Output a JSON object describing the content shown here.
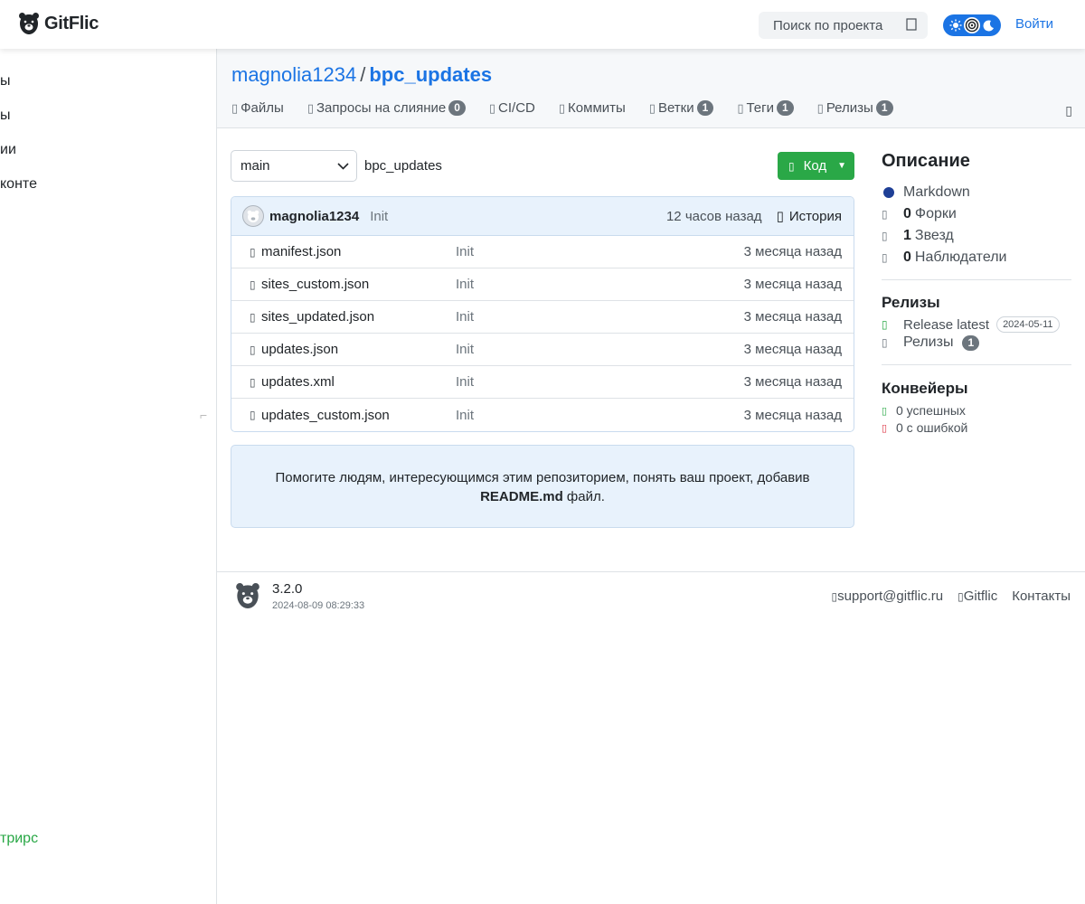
{
  "header": {
    "logo_text": "GitFlic",
    "search_placeholder": "Поиск по проекта",
    "login_label": "Войти",
    "theme_icons": [
      "sun-icon",
      "auto-icon",
      "moon-icon"
    ]
  },
  "left_panel": {
    "items": [
      "ы",
      "ы",
      "ии",
      "конте"
    ],
    "bottom_items": [
      "",
      "трирс"
    ]
  },
  "repo": {
    "owner": "magnolia1234",
    "separator": "/",
    "name": "bpc_updates",
    "tabs": [
      {
        "label": "Файлы",
        "icon": "file-icon"
      },
      {
        "label": "Запросы на слияние",
        "count": "0",
        "icon": "merge-icon"
      },
      {
        "label": "CI/CD",
        "icon": "cicd-icon"
      },
      {
        "label": "Коммиты",
        "icon": "commit-icon"
      },
      {
        "label": "Ветки",
        "count": "1",
        "icon": "branch-icon"
      },
      {
        "label": "Теги",
        "count": "1",
        "icon": "tag-icon"
      },
      {
        "label": "Релизы",
        "count": "1",
        "icon": "release-icon"
      }
    ]
  },
  "toolbar": {
    "branch": "main",
    "path": "bpc_updates",
    "code_button": "Код"
  },
  "last_commit": {
    "author": "magnolia1234",
    "message": "Init",
    "time": "12 часов назад",
    "history_label": "История"
  },
  "files": [
    {
      "name": "manifest.json",
      "message": "Init",
      "time": "3 месяца назад"
    },
    {
      "name": "sites_custom.json",
      "message": "Init",
      "time": "3 месяца назад"
    },
    {
      "name": "sites_updated.json",
      "message": "Init",
      "time": "3 месяца назад"
    },
    {
      "name": "updates.json",
      "message": "Init",
      "time": "3 месяца назад"
    },
    {
      "name": "updates.xml",
      "message": "Init",
      "time": "3 месяца назад"
    },
    {
      "name": "updates_custom.json",
      "message": "Init",
      "time": "3 месяца назад"
    }
  ],
  "readme_hint": {
    "text_before": "Помогите людям, интересующимся этим репозиторием, понять ваш проект, добавив",
    "file": "README.md",
    "text_after": "файл."
  },
  "sidebar": {
    "description_title": "Описание",
    "language": "Markdown",
    "language_color": "#1e3f96",
    "forks_count": "0",
    "forks_label": "Форки",
    "stars_count": "1",
    "stars_label": "Звезд",
    "watchers_count": "0",
    "watchers_label": "Наблюдатели",
    "releases_title": "Релизы",
    "release_latest": "Release latest",
    "release_date": "2024-05-11",
    "releases_label": "Релизы",
    "releases_count": "1",
    "pipelines_title": "Конвейеры",
    "pipelines_success": "0 успешных",
    "pipelines_failed": "0 с ошибкой"
  },
  "footer": {
    "version": "3.2.0",
    "build_date": "2024-08-09 08:29:33",
    "support_email": "support@gitflic.ru",
    "gitflic_link": "Gitflic",
    "contacts_link": "Контакты"
  },
  "colors": {
    "accent": "#1b74e4",
    "success": "#2aa847",
    "danger": "#dc3545"
  }
}
